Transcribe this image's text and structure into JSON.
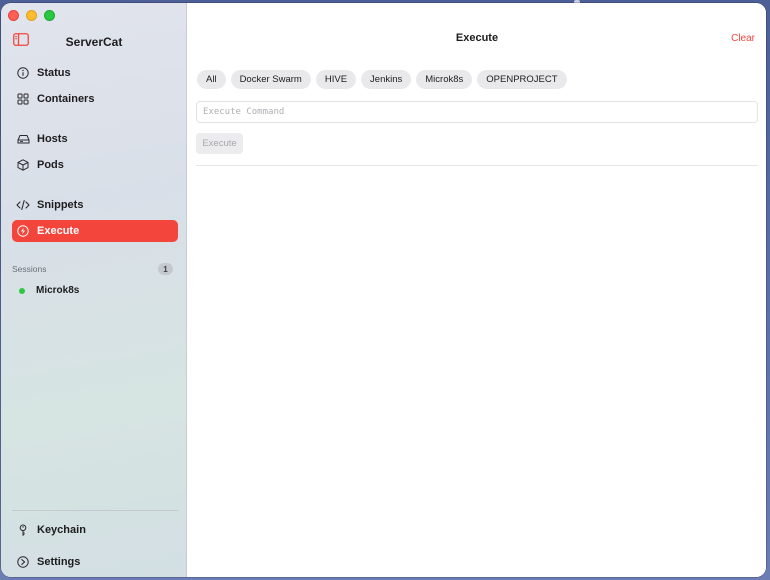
{
  "app": {
    "title": "ServerCat"
  },
  "sidebar": {
    "items": [
      {
        "label": "Status",
        "icon": "info-circle-icon"
      },
      {
        "label": "Containers",
        "icon": "grid-icon"
      },
      {
        "label": "Hosts",
        "icon": "drive-icon"
      },
      {
        "label": "Pods",
        "icon": "cube-icon"
      },
      {
        "label": "Snippets",
        "icon": "code-icon"
      },
      {
        "label": "Execute",
        "icon": "bolt-icon",
        "active": true
      }
    ],
    "sessions": {
      "label": "Sessions",
      "count": "1",
      "items": [
        {
          "label": "Microk8s",
          "status": "connected"
        }
      ]
    },
    "footer": [
      {
        "label": "Keychain",
        "icon": "key-icon"
      },
      {
        "label": "Settings",
        "icon": "settings-icon"
      }
    ]
  },
  "main": {
    "title": "Execute",
    "clear_label": "Clear",
    "filters": [
      "All",
      "Docker Swarm",
      "HIVE",
      "Jenkins",
      "Microk8s",
      "OPENPROJECT"
    ],
    "command_placeholder": "Execute Command",
    "command_value": "",
    "execute_label": "Execute"
  },
  "colors": {
    "accent": "#f4453c",
    "session_online": "#30c83f"
  }
}
